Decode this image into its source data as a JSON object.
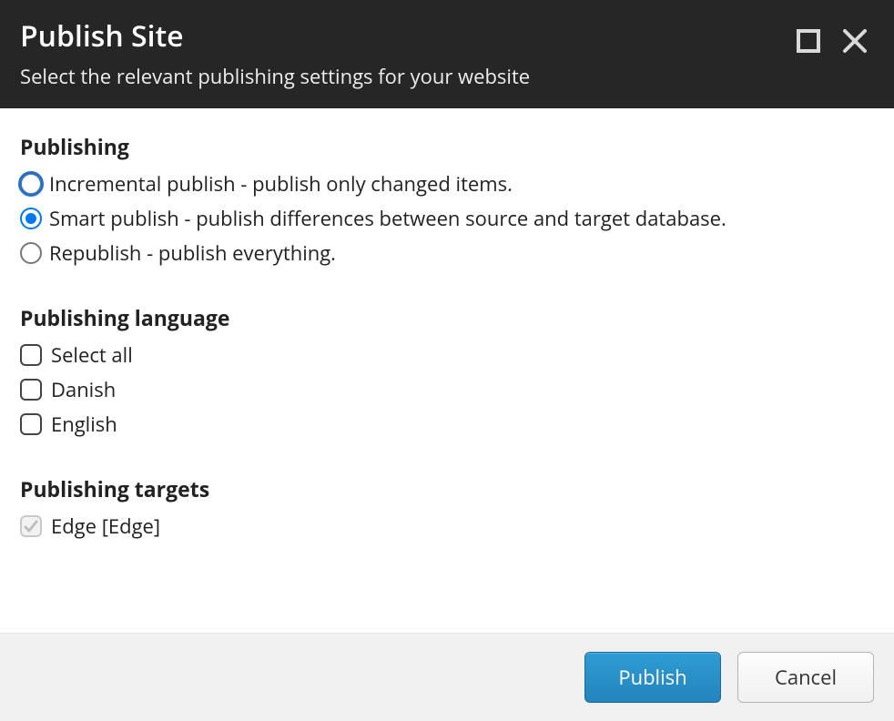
{
  "header": {
    "title": "Publish Site",
    "subtitle": "Select the relevant publishing settings for your website"
  },
  "sections": {
    "publishing": {
      "title": "Publishing",
      "options": [
        {
          "label": "Incremental publish - publish only changed items.",
          "selected": false,
          "focused": true
        },
        {
          "label": "Smart publish - publish differences between source and target database.",
          "selected": true,
          "focused": false
        },
        {
          "label": "Republish - publish everything.",
          "selected": false,
          "focused": false
        }
      ]
    },
    "language": {
      "title": "Publishing language",
      "options": [
        {
          "label": "Select all",
          "checked": false,
          "disabled": false
        },
        {
          "label": "Danish",
          "checked": false,
          "disabled": false
        },
        {
          "label": "English",
          "checked": false,
          "disabled": false
        }
      ]
    },
    "targets": {
      "title": "Publishing targets",
      "options": [
        {
          "label": "Edge [Edge]",
          "checked": true,
          "disabled": true
        }
      ]
    }
  },
  "footer": {
    "publish_label": "Publish",
    "cancel_label": "Cancel"
  }
}
